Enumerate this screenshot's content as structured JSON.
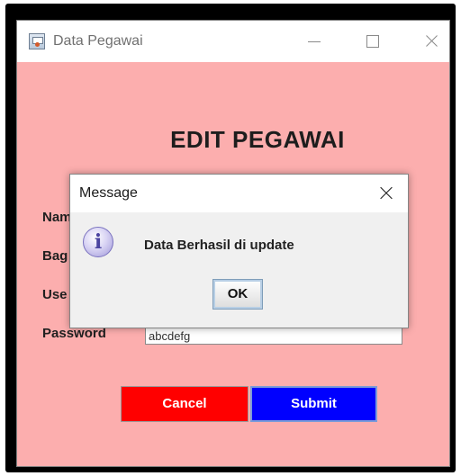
{
  "window": {
    "title": "Data Pegawai",
    "icon": "java-app-icon"
  },
  "form": {
    "heading": "EDIT PEGAWAI",
    "fields": [
      {
        "label": "Nam",
        "value": ""
      },
      {
        "label": "Bag",
        "value": ""
      },
      {
        "label": "Use",
        "value": ""
      },
      {
        "label": "Password",
        "value": "abcdefg"
      }
    ],
    "cancel_label": "Cancel",
    "submit_label": "Submit"
  },
  "dialog": {
    "title": "Message",
    "icon": "info-icon",
    "icon_glyph": "i",
    "message": "Data Berhasil di update",
    "ok_label": "OK"
  },
  "colors": {
    "background": "#fcaeae",
    "cancel": "#ff0000",
    "submit": "#0000ff"
  }
}
